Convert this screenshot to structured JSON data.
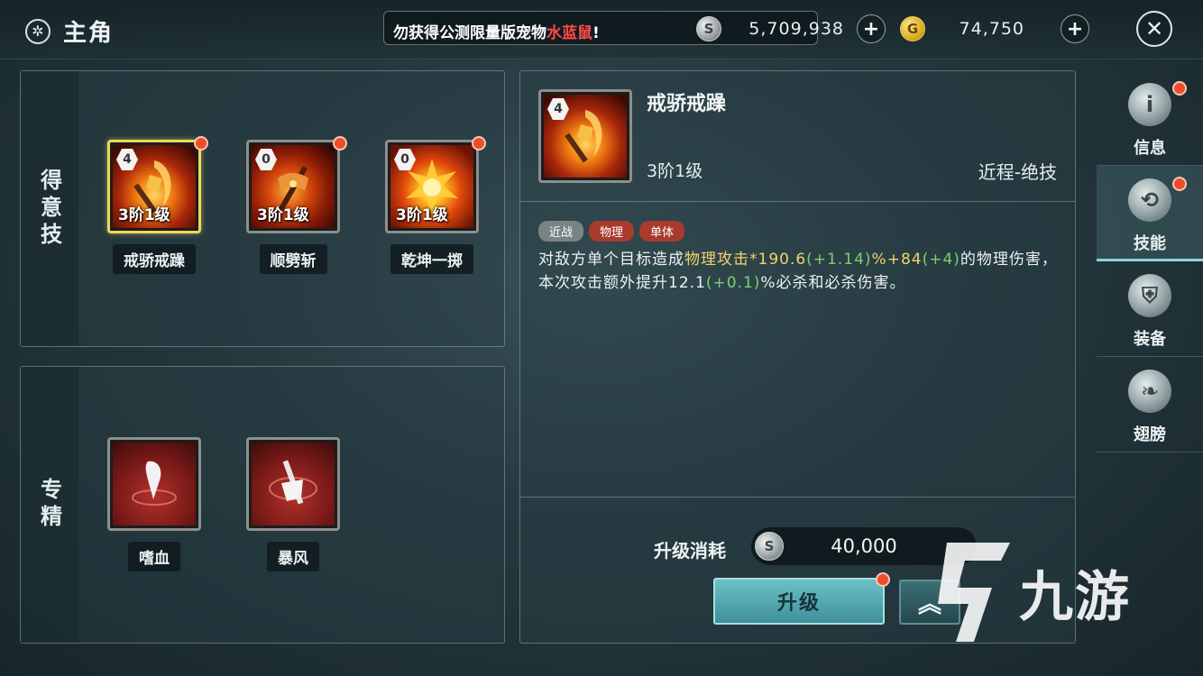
{
  "header": {
    "title": "主角",
    "ticker": {
      "prefix": "勿获得公测限量版宠物",
      "pet": "水蓝鼠",
      "suffix": "!"
    },
    "silver_amount": "5,709,938",
    "gold_amount": "74,750",
    "silver_icon": "silver-coin-icon",
    "gold_icon": "gold-coin-icon"
  },
  "favored_skills": {
    "section_label": "得意技",
    "items": [
      {
        "name": "戒骄戒躁",
        "rank": "3阶1级",
        "badge": "4",
        "selected": true
      },
      {
        "name": "顺劈斩",
        "rank": "3阶1级",
        "badge": "0",
        "selected": false
      },
      {
        "name": "乾坤一掷",
        "rank": "3阶1级",
        "badge": "0",
        "selected": false
      }
    ]
  },
  "mastery": {
    "section_label": "专精",
    "items": [
      {
        "name": "嗜血"
      },
      {
        "name": "暴风"
      }
    ]
  },
  "detail": {
    "badge": "4",
    "name": "戒骄戒躁",
    "level": "3阶1级",
    "type": "近程-绝技",
    "tags": [
      "近战",
      "物理",
      "单体"
    ],
    "desc": {
      "p1": "对敌方单个目标造成",
      "hl1": "物理攻击",
      "p2": "*190.6",
      "g1": "(+1.14)",
      "p3": "%+84",
      "g2": "(+4)",
      "p4": "的物理伤害，本次攻击额外提升12.1",
      "g3": "(+0.1)",
      "p5": "%必杀和必杀伤害。"
    },
    "cost_label": "升级消耗",
    "cost_value": "40,000",
    "upgrade_label": "升级",
    "max_upgrade_icon": "double-chevron-up-icon"
  },
  "tabs": [
    {
      "label": "信息",
      "icon": "info-icon",
      "active": false
    },
    {
      "label": "技能",
      "icon": "skill-icon",
      "active": true
    },
    {
      "label": "装备",
      "icon": "armor-icon",
      "active": false
    },
    {
      "label": "翅膀",
      "icon": "wing-icon",
      "active": false
    }
  ],
  "watermark": {
    "text": "九游"
  },
  "colors": {
    "accent": "#6cc2c8",
    "highlight": "#f2d46a",
    "bonus": "#7fd06b",
    "alert": "#ee4d2b",
    "selected_border": "#f0d75a"
  }
}
